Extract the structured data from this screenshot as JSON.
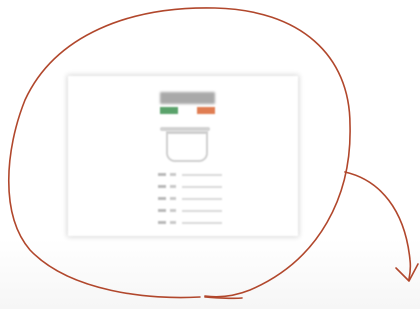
{
  "colors": {
    "annotation_stroke": "#b1472c",
    "swatch_green": "#5aa26b",
    "swatch_orange": "#e07d52"
  },
  "thumbnail": {
    "swatches": [
      "green",
      "orange"
    ],
    "row_count": 5
  },
  "caption": {
    "text": ""
  }
}
